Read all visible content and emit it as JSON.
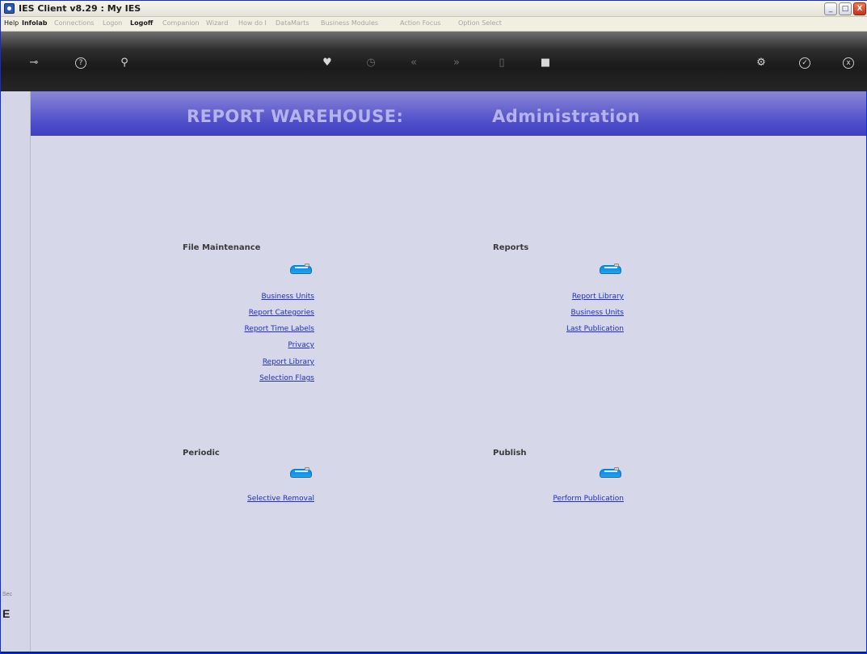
{
  "window": {
    "title": "IES Client v8.29 : My IES",
    "min_label": "_",
    "max_label": "□",
    "close_label": "X"
  },
  "menu": [
    {
      "label": "Help",
      "style": "on"
    },
    {
      "label": "Infolab",
      "style": "bold"
    },
    {
      "label": "Connections",
      "style": "dim"
    },
    {
      "label": "Logon",
      "style": "dim"
    },
    {
      "label": "Logoff",
      "style": "bold"
    },
    {
      "label": "Companion",
      "style": "dim"
    },
    {
      "label": "Wizard",
      "style": "dim"
    },
    {
      "label": "How do I",
      "style": "dim"
    },
    {
      "label": "DataMarts",
      "style": "dim"
    },
    {
      "label": "Business Modules",
      "style": "dim"
    },
    {
      "label": "Action Focus",
      "style": "dim"
    },
    {
      "label": "Option Select",
      "style": "dim"
    }
  ],
  "toolbar": [
    {
      "icon": "key-icon",
      "glyph": "⊸"
    },
    {
      "icon": "help-icon",
      "glyph": "?"
    },
    {
      "icon": "search-icon",
      "glyph": "⚲"
    },
    {
      "icon": "heart-icon",
      "glyph": "♥"
    },
    {
      "icon": "clock-icon",
      "glyph": "◷"
    },
    {
      "icon": "rewind-icon",
      "glyph": "«"
    },
    {
      "icon": "forward-icon",
      "glyph": "»"
    },
    {
      "icon": "trash-icon",
      "glyph": "▯"
    },
    {
      "icon": "stop-icon",
      "glyph": "■"
    },
    {
      "icon": "settings-icon",
      "glyph": "⚙"
    },
    {
      "icon": "check-icon",
      "glyph": "✓"
    },
    {
      "icon": "close-icon",
      "glyph": "x"
    }
  ],
  "banner": {
    "left": "REPORT WAREHOUSE:",
    "right": "Administration"
  },
  "sections": {
    "file_maintenance": {
      "title": "File Maintenance",
      "links": [
        "Business Units",
        "Report Categories",
        "Report Time Labels",
        "Privacy",
        "Report Library",
        "Selection Flags"
      ]
    },
    "reports": {
      "title": "Reports",
      "links": [
        "Report Library",
        "Business Units",
        "Last Publication"
      ]
    },
    "periodic": {
      "title": "Periodic",
      "links": [
        "Selective Removal"
      ]
    },
    "publish": {
      "title": "Publish",
      "links": [
        "Perform Publication"
      ]
    }
  },
  "left_strip": {
    "text1": "Sec",
    "text2": "E"
  },
  "colors": {
    "banner": "#4f4ec9",
    "panel": "#d7d7ea",
    "link": "#1f2ec4"
  }
}
